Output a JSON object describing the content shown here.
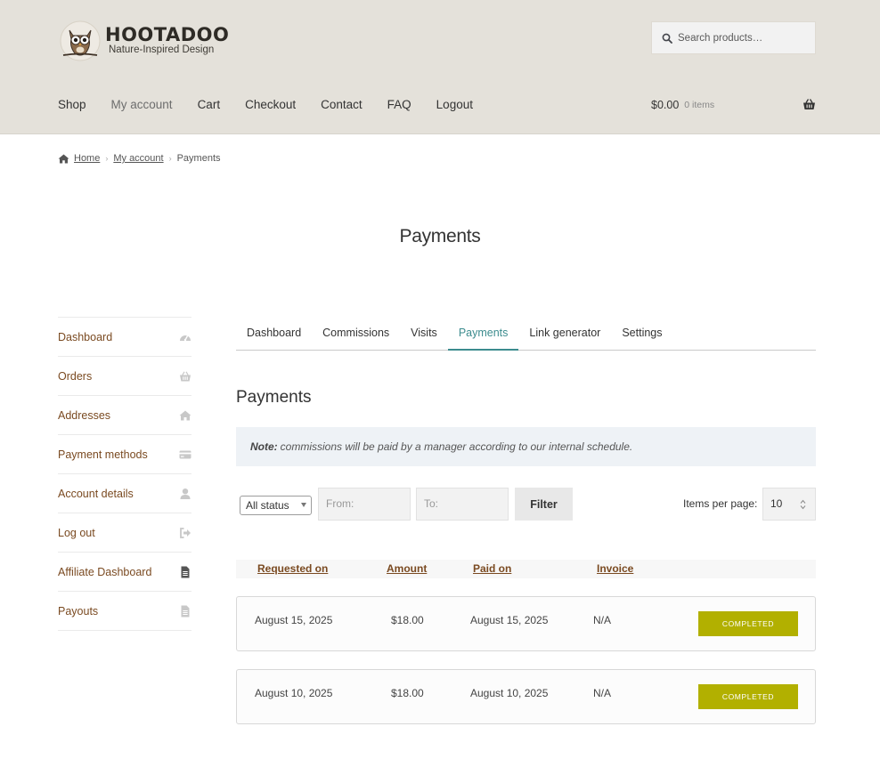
{
  "brand": {
    "title": "HOOTADOO",
    "subtitle": "Nature-Inspired Design"
  },
  "search": {
    "placeholder": "Search products…"
  },
  "nav": [
    "Shop",
    "My account",
    "Cart",
    "Checkout",
    "Contact",
    "FAQ",
    "Logout"
  ],
  "cart": {
    "amount": "$0.00",
    "count": "0 items"
  },
  "breadcrumb": {
    "home": "Home",
    "account": "My account",
    "current": "Payments"
  },
  "page_title": "Payments",
  "sidebar": {
    "items": [
      {
        "label": "Dashboard",
        "icon": "gauge-icon"
      },
      {
        "label": "Orders",
        "icon": "basket-icon"
      },
      {
        "label": "Addresses",
        "icon": "home-icon"
      },
      {
        "label": "Payment methods",
        "icon": "credit-card-icon"
      },
      {
        "label": "Account details",
        "icon": "user-icon"
      },
      {
        "label": "Log out",
        "icon": "sign-out-icon"
      },
      {
        "label": "Affiliate Dashboard",
        "icon": "document-icon"
      },
      {
        "label": "Payouts",
        "icon": "document-outline-icon"
      }
    ]
  },
  "tabs": [
    "Dashboard",
    "Commissions",
    "Visits",
    "Payments",
    "Link generator",
    "Settings"
  ],
  "section_title": "Payments",
  "note": {
    "label": "Note:",
    "text": "commissions will be paid by a manager according to our internal schedule."
  },
  "filters": {
    "status": "All status",
    "from_placeholder": "From:",
    "to_placeholder": "To:",
    "filter_label": "Filter",
    "items_per_page_label": "Items per page:",
    "items_per_page": "10"
  },
  "table": {
    "headers": [
      "Requested on",
      "Amount",
      "Paid on",
      "Invoice"
    ],
    "rows": [
      {
        "requested": "August 15, 2025",
        "amount": "$18.00",
        "paid": "August 15, 2025",
        "invoice": "N/A",
        "status": "COMPLETED"
      },
      {
        "requested": "August 10, 2025",
        "amount": "$18.00",
        "paid": "August 10, 2025",
        "invoice": "N/A",
        "status": "COMPLETED"
      }
    ]
  },
  "colors": {
    "header_bg": "#e4e1da",
    "link": "#7a4a21",
    "accent": "#3c8c8e",
    "badge": "#b2b000"
  }
}
